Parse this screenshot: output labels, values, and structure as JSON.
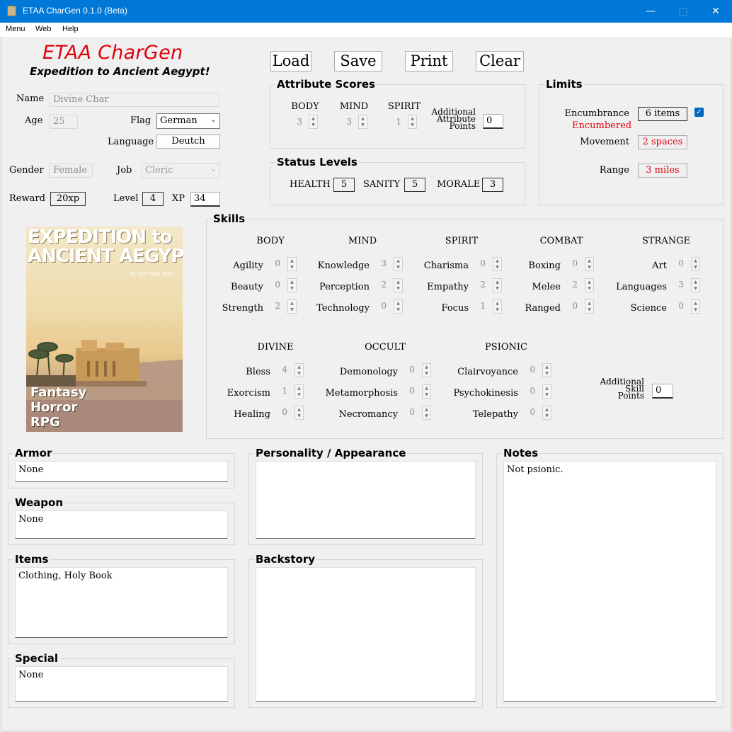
{
  "window": {
    "title": "ETAA CharGen 0.1.0 (Beta)"
  },
  "menu": [
    "Menu",
    "Web",
    "Help"
  ],
  "header": {
    "title": "ETAA CharGen",
    "subtitle": "Expedition to Ancient Aegypt!"
  },
  "toolbar": {
    "load": "Load",
    "save": "Save",
    "print": "Print",
    "clear": "Clear"
  },
  "character": {
    "name_label": "Name",
    "name_placeholder": "Divine Char",
    "age_label": "Age",
    "age_placeholder": "25",
    "flag_label": "Flag",
    "flag_value": "German",
    "language_label": "Language",
    "language_value": "Deutch",
    "gender_label": "Gender",
    "gender_placeholder": "Female",
    "job_label": "Job",
    "job_value": "Cleric",
    "reward_label": "Reward",
    "reward_value": "20xp",
    "level_label": "Level",
    "level_value": "4",
    "xp_label": "XP",
    "xp_value": "34"
  },
  "attributes": {
    "title": "Attribute Scores",
    "body_label": "BODY",
    "body_value": "3",
    "mind_label": "MIND",
    "mind_value": "3",
    "spirit_label": "SPIRIT",
    "spirit_value": "1",
    "additional_line1": "Additional",
    "additional_line2": "Attribute",
    "additional_line3": "Points",
    "additional_value": "0"
  },
  "status": {
    "title": "Status Levels",
    "health_label": "HEALTH",
    "health_value": "5",
    "sanity_label": "SANITY",
    "sanity_value": "5",
    "morale_label": "MORALE",
    "morale_value": "3"
  },
  "limits": {
    "title": "Limits",
    "encumbrance_label": "Encumbrance",
    "encumbrance_value": "6 items",
    "encumbrance_status": "Encumbered",
    "encumbrance_checked": true,
    "movement_label": "Movement",
    "movement_value": "2 spaces",
    "range_label": "Range",
    "range_value": "3 miles"
  },
  "skills": {
    "title": "Skills",
    "body": {
      "header": "BODY",
      "items": [
        {
          "label": "Agility",
          "value": "0"
        },
        {
          "label": "Beauty",
          "value": "0"
        },
        {
          "label": "Strength",
          "value": "2"
        }
      ]
    },
    "mind": {
      "header": "MIND",
      "items": [
        {
          "label": "Knowledge",
          "value": "3"
        },
        {
          "label": "Perception",
          "value": "2"
        },
        {
          "label": "Technology",
          "value": "0"
        }
      ]
    },
    "spirit": {
      "header": "SPIRIT",
      "items": [
        {
          "label": "Charisma",
          "value": "0"
        },
        {
          "label": "Empathy",
          "value": "2"
        },
        {
          "label": "Focus",
          "value": "1"
        }
      ]
    },
    "combat": {
      "header": "COMBAT",
      "items": [
        {
          "label": "Boxing",
          "value": "0"
        },
        {
          "label": "Melee",
          "value": "2"
        },
        {
          "label": "Ranged",
          "value": "0"
        }
      ]
    },
    "strange": {
      "header": "STRANGE",
      "items": [
        {
          "label": "Art",
          "value": "0"
        },
        {
          "label": "Languages",
          "value": "3"
        },
        {
          "label": "Science",
          "value": "0"
        }
      ]
    },
    "divine": {
      "header": "DIVINE",
      "items": [
        {
          "label": "Bless",
          "value": "4"
        },
        {
          "label": "Exorcism",
          "value": "1"
        },
        {
          "label": "Healing",
          "value": "0"
        }
      ]
    },
    "occult": {
      "header": "OCCULT",
      "items": [
        {
          "label": "Demonology",
          "value": "0"
        },
        {
          "label": "Metamorphosis",
          "value": "0"
        },
        {
          "label": "Necromancy",
          "value": "0"
        }
      ]
    },
    "psionic": {
      "header": "PSIONIC",
      "items": [
        {
          "label": "Clairvoyance",
          "value": "0"
        },
        {
          "label": "Psychokinesis",
          "value": "0"
        },
        {
          "label": "Telepathy",
          "value": "0"
        }
      ]
    },
    "additional_line1": "Additional",
    "additional_line2": "Skill",
    "additional_line3": "Points",
    "additional_value": "0"
  },
  "cover": {
    "line1": "EXPEDITION to",
    "line2": "ANCIENT AEGYPT!",
    "byline": "by Total Party Skills",
    "tag1": "Fantasy",
    "tag2": "Horror",
    "tag3": "RPG"
  },
  "panels": {
    "armor": {
      "title": "Armor",
      "value": "None"
    },
    "weapon": {
      "title": "Weapon",
      "value": "None"
    },
    "items": {
      "title": "Items",
      "value": "Clothing, Holy Book"
    },
    "special": {
      "title": "Special",
      "value": "None"
    },
    "personality": {
      "title": "Personality / Appearance",
      "value": ""
    },
    "backstory": {
      "title": "Backstory",
      "value": ""
    },
    "notes": {
      "title": "Notes",
      "value": "Not psionic."
    }
  },
  "colors": {
    "titlebar": "#0078d7",
    "accent_red": "#e0000f",
    "checkbox": "#0067c0"
  }
}
